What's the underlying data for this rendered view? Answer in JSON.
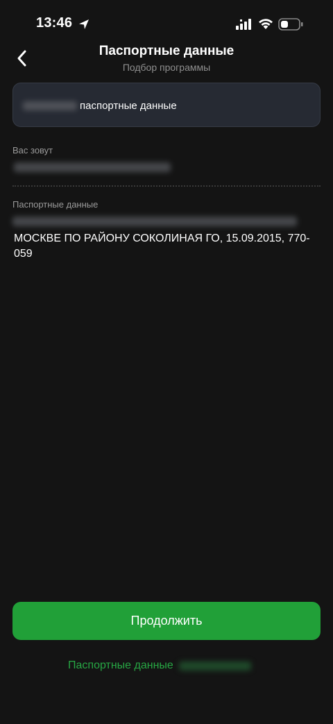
{
  "status_bar": {
    "time": "13:46"
  },
  "header": {
    "title": "Паспортные данные",
    "subtitle": "Подбор программы"
  },
  "info_card": {
    "text": "паспортные данные"
  },
  "fields": {
    "name_label": "Вас зовут",
    "passport_label": "Паспортные данные",
    "passport_value": "МОСКВЕ ПО РАЙОНУ СОКОЛИНАЯ ГО, 15.09.2015, 770-059"
  },
  "actions": {
    "continue_label": "Продолжить",
    "link_label": "Паспортные данные"
  },
  "colors": {
    "background": "#141414",
    "accent": "#21a038",
    "link": "#27a844",
    "card": "#262a33"
  },
  "icons": {
    "back": "chevron-left-icon",
    "location": "location-arrow-icon",
    "signal": "cellular-signal-icon",
    "wifi": "wifi-icon",
    "battery": "battery-icon"
  }
}
